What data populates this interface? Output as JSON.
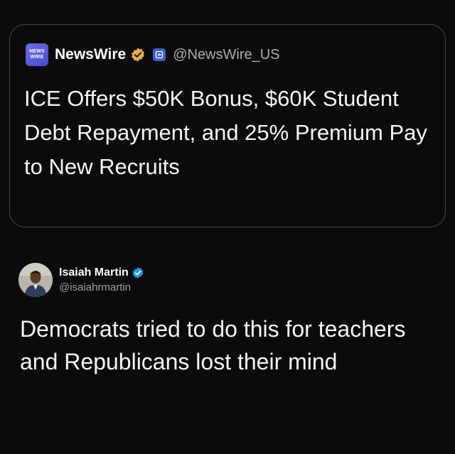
{
  "quoted_tweet": {
    "logo_text_line1": "NEWS",
    "logo_text_line2": "WIRE",
    "display_name": "NewsWire",
    "handle": "@NewsWire_US",
    "text": "ICE Offers $50K Bonus, $60K Student Debt Repayment, and 25% Premium Pay to New Recruits",
    "badge_icon": "gold-verified-badge",
    "affiliation_icon": "affiliate-icon"
  },
  "tweet": {
    "display_name": "Isaiah Martin",
    "handle": "@isaiahrmartin",
    "text": "Democrats tried to do this for teachers and Republicans lost their mind",
    "badge_icon": "blue-verified-badge"
  },
  "colors": {
    "background": "#0b0b0c",
    "card_border": "#4a4a4e",
    "gold_badge": "#e8b23a",
    "blue_badge": "#1d9bf0",
    "logo": "#5757d6",
    "handle_text": "#9aa0a6"
  }
}
